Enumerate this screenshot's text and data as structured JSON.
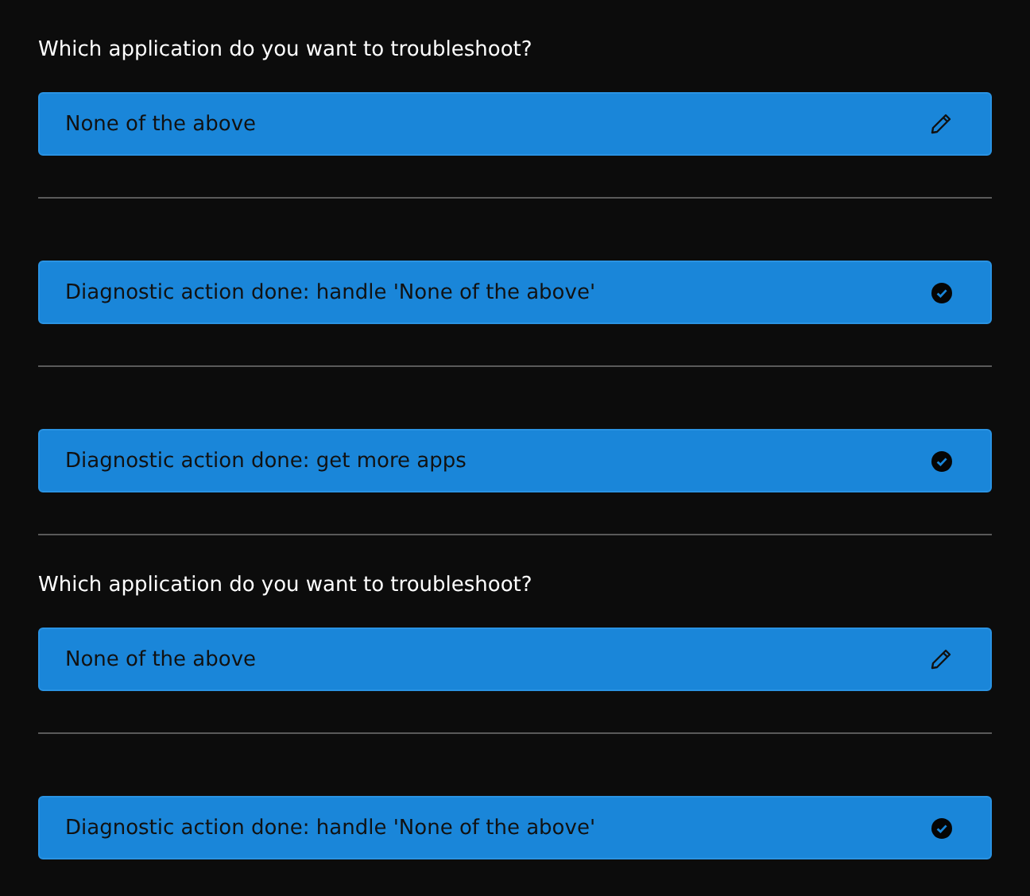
{
  "entries": [
    {
      "question": "Which application do you want to troubleshoot?",
      "card": {
        "kind": "edit",
        "text": "None of the above"
      }
    },
    {
      "card": {
        "kind": "done",
        "text": "Diagnostic action done: handle 'None of the above'"
      }
    },
    {
      "card": {
        "kind": "done",
        "text": "Diagnostic action done: get more apps"
      }
    },
    {
      "question": "Which application do you want to troubleshoot?",
      "card": {
        "kind": "edit",
        "text": "None of the above"
      }
    },
    {
      "card": {
        "kind": "done",
        "text": "Diagnostic action done: handle 'None of the above'"
      }
    }
  ]
}
